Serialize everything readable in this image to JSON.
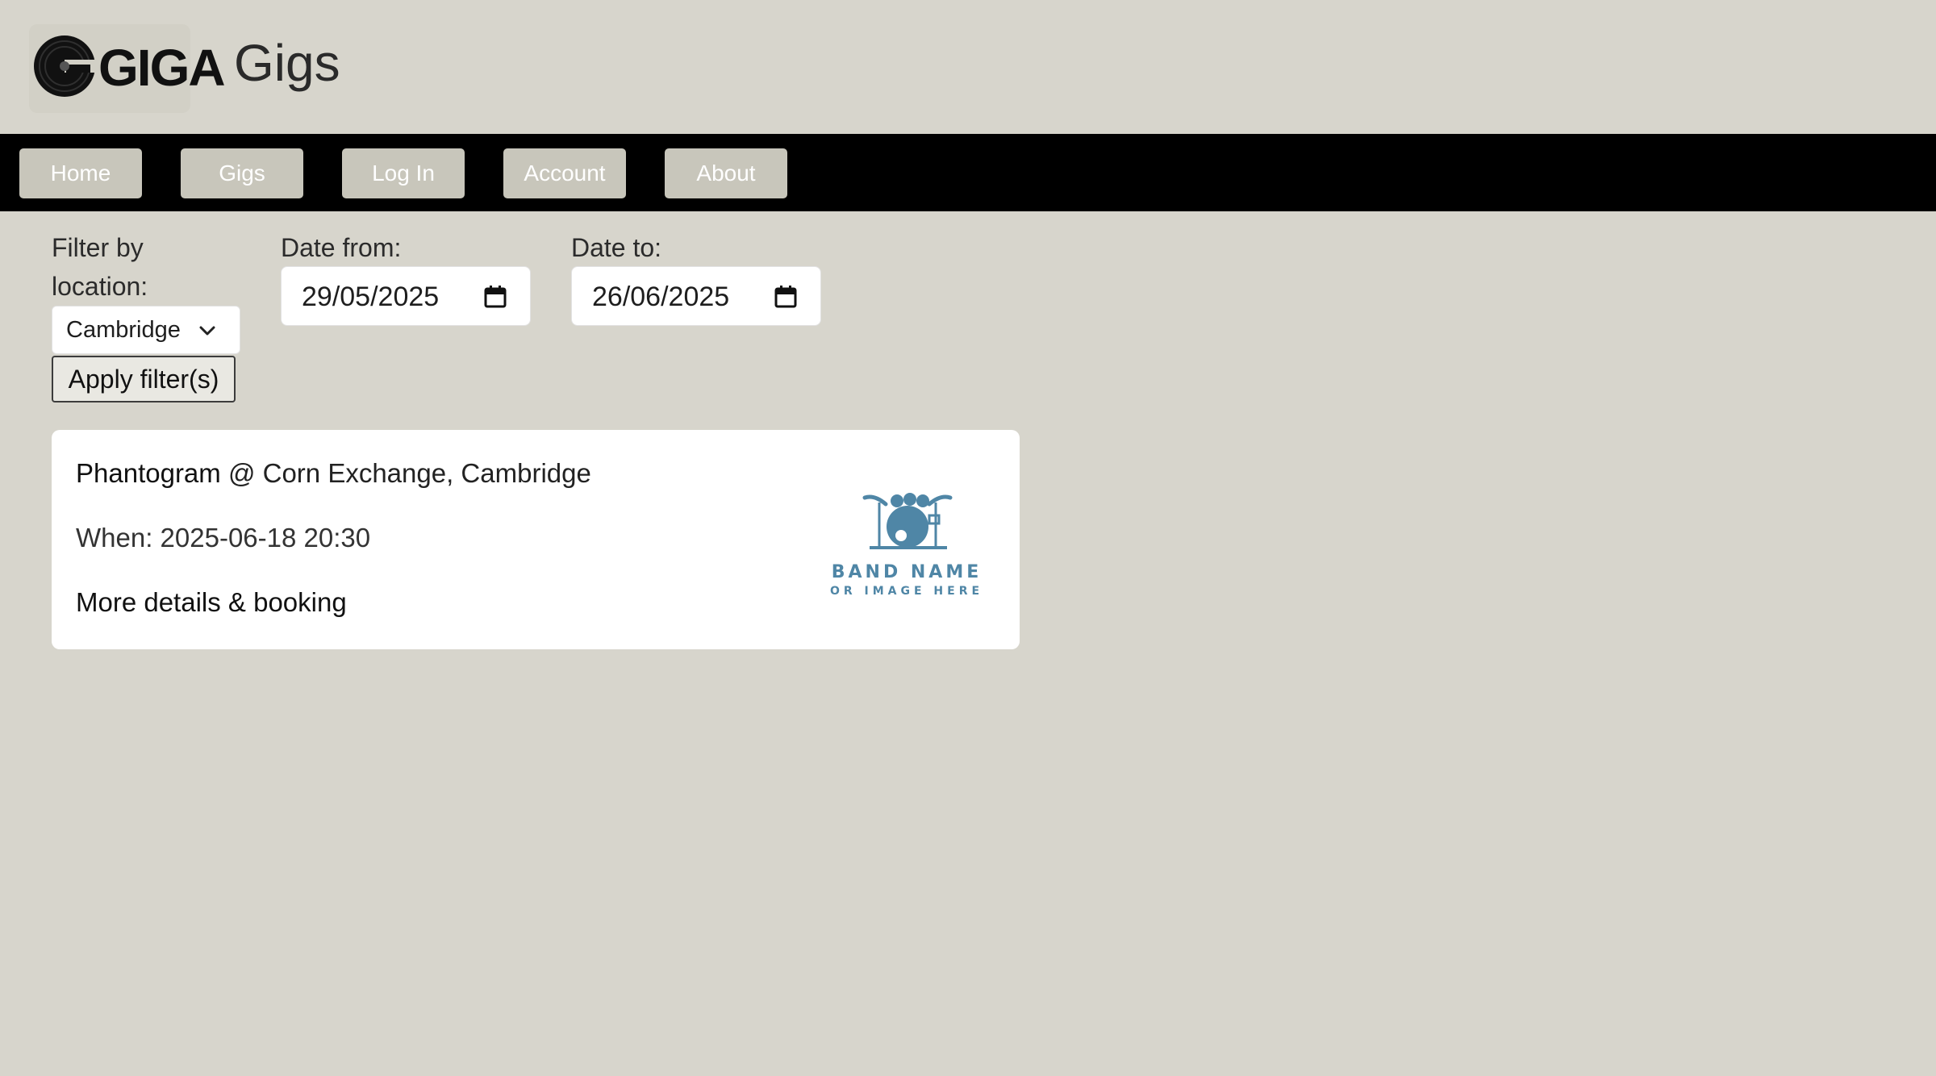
{
  "header": {
    "logo_text": "GIGA",
    "title": "Gigs"
  },
  "nav": {
    "items": [
      {
        "label": "Home"
      },
      {
        "label": "Gigs"
      },
      {
        "label": "Log In"
      },
      {
        "label": "Account"
      },
      {
        "label": "About"
      }
    ]
  },
  "filters": {
    "location_label": [
      "Filter by",
      "location:"
    ],
    "location_value": "Cambridge",
    "date_from_label": "Date from:",
    "date_from_value": "29/05/2025",
    "date_to_label": "Date to:",
    "date_to_value": "26/06/2025",
    "apply_label": "Apply filter(s)"
  },
  "gigs": [
    {
      "band": "Phantogram",
      "venue": " @ Corn Exchange, Cambridge",
      "when": "When: 2025-06-18 20:30",
      "link": "More details & booking",
      "image_caption_1": "BAND NAME",
      "image_caption_2": "OR IMAGE HERE"
    }
  ],
  "colors": {
    "background": "#d7d5cc",
    "nav_background": "#000000",
    "nav_button": "#c8c6bb",
    "placeholder_blue": "#4f86a6"
  },
  "icons": {
    "date_picker": "calendar-icon",
    "select": "chevron-down-icon",
    "band_placeholder": "drum-kit-icon"
  }
}
